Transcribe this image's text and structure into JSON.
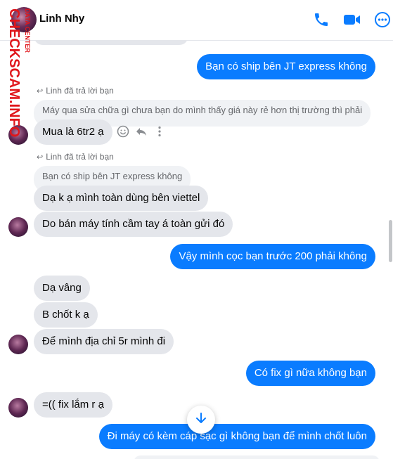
{
  "header": {
    "contact_name": "Linh Nhy"
  },
  "watermark": {
    "line1": "CHECKSCAM.INFO",
    "line2": "DATA CENTER"
  },
  "messages": [
    {
      "id": "m0",
      "text": "Bạn có ship bên JT express không"
    },
    {
      "id": "m1_meta",
      "text": "Linh đã trả lời bạn"
    },
    {
      "id": "m1_quote",
      "text": "Máy qua sửa chữa gì chưa bạn do mình thấy giá này rẻ hơn thị trường thì phải"
    },
    {
      "id": "m1",
      "text": "Mua là 6tr2 ạ"
    },
    {
      "id": "m2_meta",
      "text": "Linh đã trả lời bạn"
    },
    {
      "id": "m2_quote",
      "text": "Bạn có ship bên JT express không"
    },
    {
      "id": "m2",
      "text": "Dạ k ạ mình toàn dùng bên viettel"
    },
    {
      "id": "m3",
      "text": "Do bán máy tính cầm tay á toàn gửi đó"
    },
    {
      "id": "m4",
      "text": "Vậy mình cọc bạn trước 200 phải không"
    },
    {
      "id": "m5",
      "text": "Dạ vâng"
    },
    {
      "id": "m6",
      "text": "B chốt k ạ"
    },
    {
      "id": "m7",
      "text": "Để mình địa chỉ 5r mình đi"
    },
    {
      "id": "m8",
      "text": "Có fix gì nữa không bạn"
    },
    {
      "id": "m9",
      "text": "=(( fix lắm r ạ"
    },
    {
      "id": "m10",
      "text": "Đi máy có kèm cáp sạc gì không bạn để mình chốt luôn"
    }
  ],
  "colors": {
    "outgoing_bubble": "#0a7cff",
    "incoming_bubble": "#e4e6eb",
    "accent": "#0a7cff",
    "watermark": "#e0161b"
  },
  "icons": [
    "phone-icon",
    "video-icon",
    "more-icon",
    "reply-arrow-icon",
    "emoji-icon",
    "reply-icon",
    "vertical-more-icon",
    "arrow-down-icon"
  ]
}
